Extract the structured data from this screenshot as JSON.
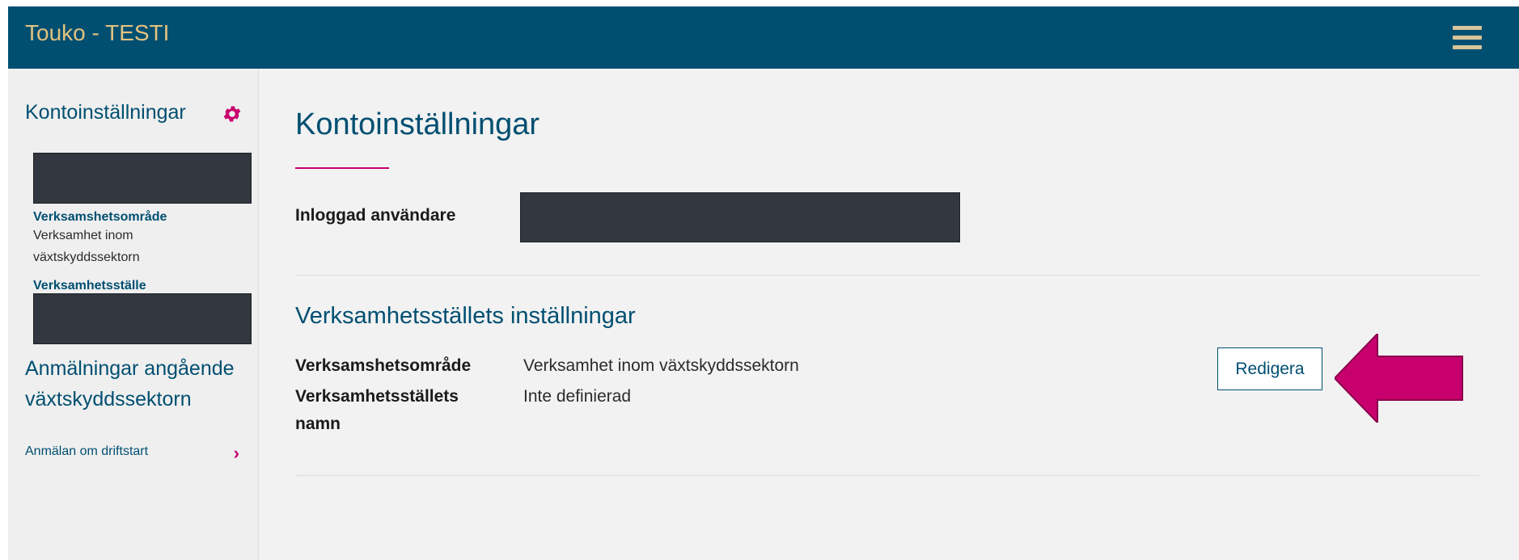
{
  "header": {
    "app_title": "Touko - TESTI"
  },
  "sidebar": {
    "settings_heading": "Kontoinställningar",
    "field1_label": "Verksamshetsområde",
    "field1_value": "Verksamhet inom växtskyddssektorn",
    "field2_label": "Verksamhetsställe",
    "notifications_heading": "Anmälningar angående växtskyddssektorn",
    "link_label": "Anmälan om driftstart"
  },
  "main": {
    "title": "Kontoinställningar",
    "logged_in_label": "Inloggad användare",
    "section_title": "Verksamhetsställets inställningar",
    "field1_label": "Verksamshetsområde",
    "field1_value": "Verksamhet inom växtskyddssektorn",
    "field2_label": "Verksamhetsställets namn",
    "field2_value": "Inte definierad",
    "edit_button": "Redigera"
  },
  "icons": {
    "gear": "gear-icon",
    "menu": "hamburger-menu-icon",
    "chevron": "chevron-right-icon",
    "arrow": "arrow-left-icon"
  },
  "colors": {
    "header_bg": "#004f71",
    "title_text": "#e3c17e",
    "accent": "#c8006e",
    "primary": "#004f71"
  }
}
